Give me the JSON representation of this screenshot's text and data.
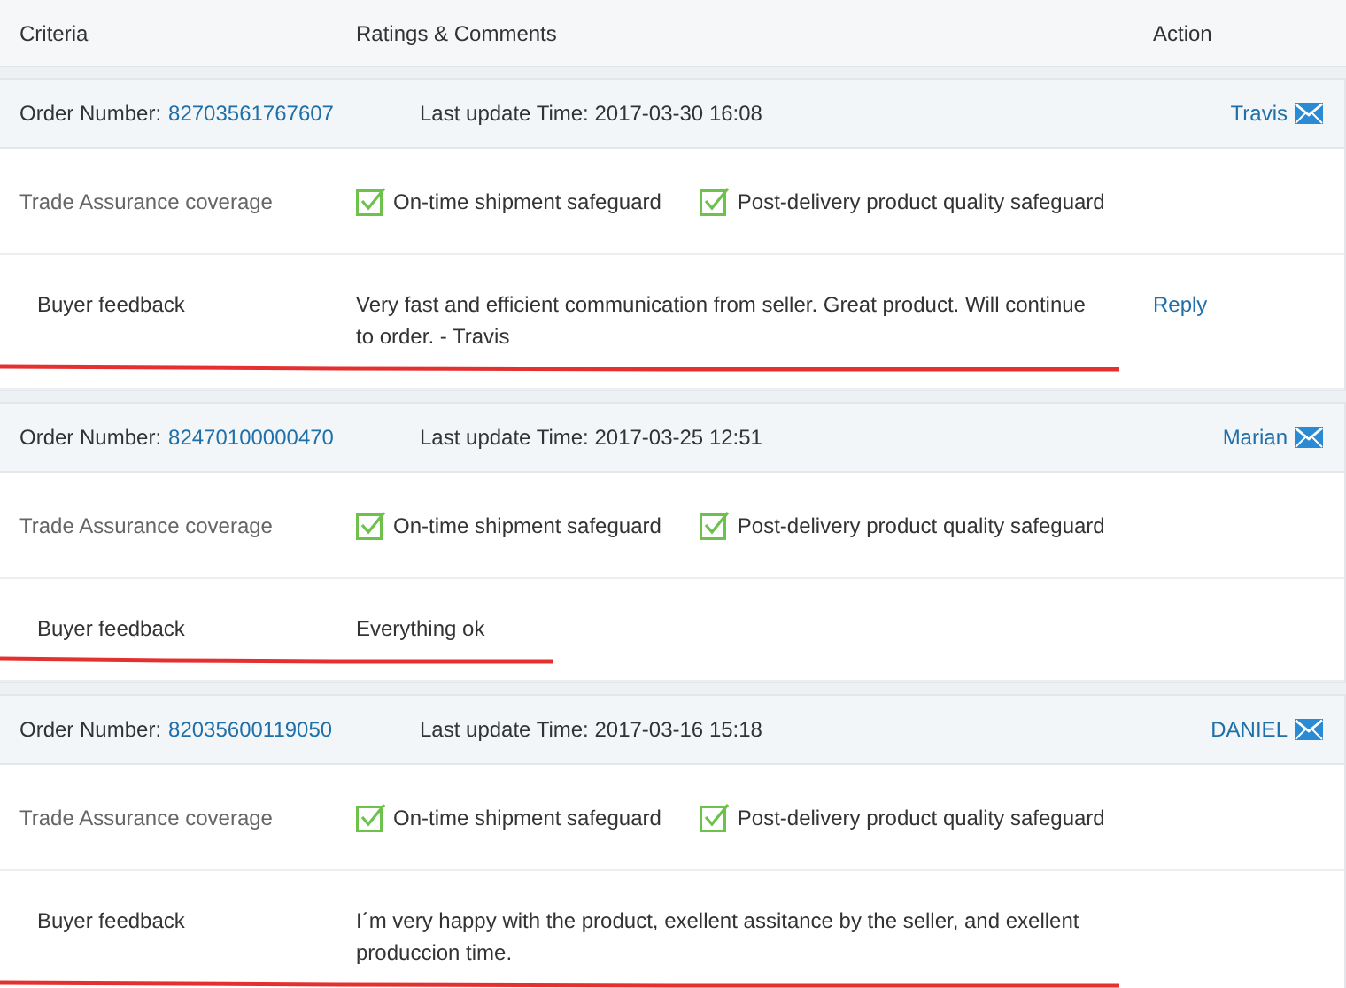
{
  "columns": [
    "Criteria",
    "Ratings & Comments",
    "Action"
  ],
  "orders": [
    {
      "order_label": "Order Number:",
      "order_number": "82703561767607",
      "update_label": "Last update Time:",
      "update_time": "2017-03-30 16:08",
      "buyer": "Travis",
      "coverage_label": "Trade Assurance coverage",
      "safeguards": [
        {
          "label": "On-time shipment safeguard",
          "checked": true
        },
        {
          "label": "Post-delivery product quality safeguard",
          "checked": true
        }
      ],
      "feedback_label": "Buyer feedback",
      "feedback": "Very fast and efficient communication from seller. Great product. Will continue to order. - Travis",
      "action": "Reply"
    },
    {
      "order_label": "Order Number:",
      "order_number": "82470100000470",
      "update_label": "Last update Time:",
      "update_time": "2017-03-25 12:51",
      "buyer": "Marian",
      "coverage_label": "Trade Assurance coverage",
      "safeguards": [
        {
          "label": "On-time shipment safeguard",
          "checked": true
        },
        {
          "label": "Post-delivery product quality safeguard",
          "checked": true
        }
      ],
      "feedback_label": "Buyer feedback",
      "feedback": "Everything ok"
    },
    {
      "order_label": "Order Number:",
      "order_number": "82035600119050",
      "update_label": "Last update Time:",
      "update_time": "2017-03-16 15:18",
      "buyer": "DANIEL",
      "coverage_label": "Trade Assurance coverage",
      "safeguards": [
        {
          "label": "On-time shipment safeguard",
          "checked": true
        },
        {
          "label": "Post-delivery product quality safeguard",
          "checked": true
        }
      ],
      "feedback_label": "Buyer feedback",
      "feedback": "I´m very happy with the product, exellent assitance by the seller, and exellent produccion time."
    }
  ]
}
